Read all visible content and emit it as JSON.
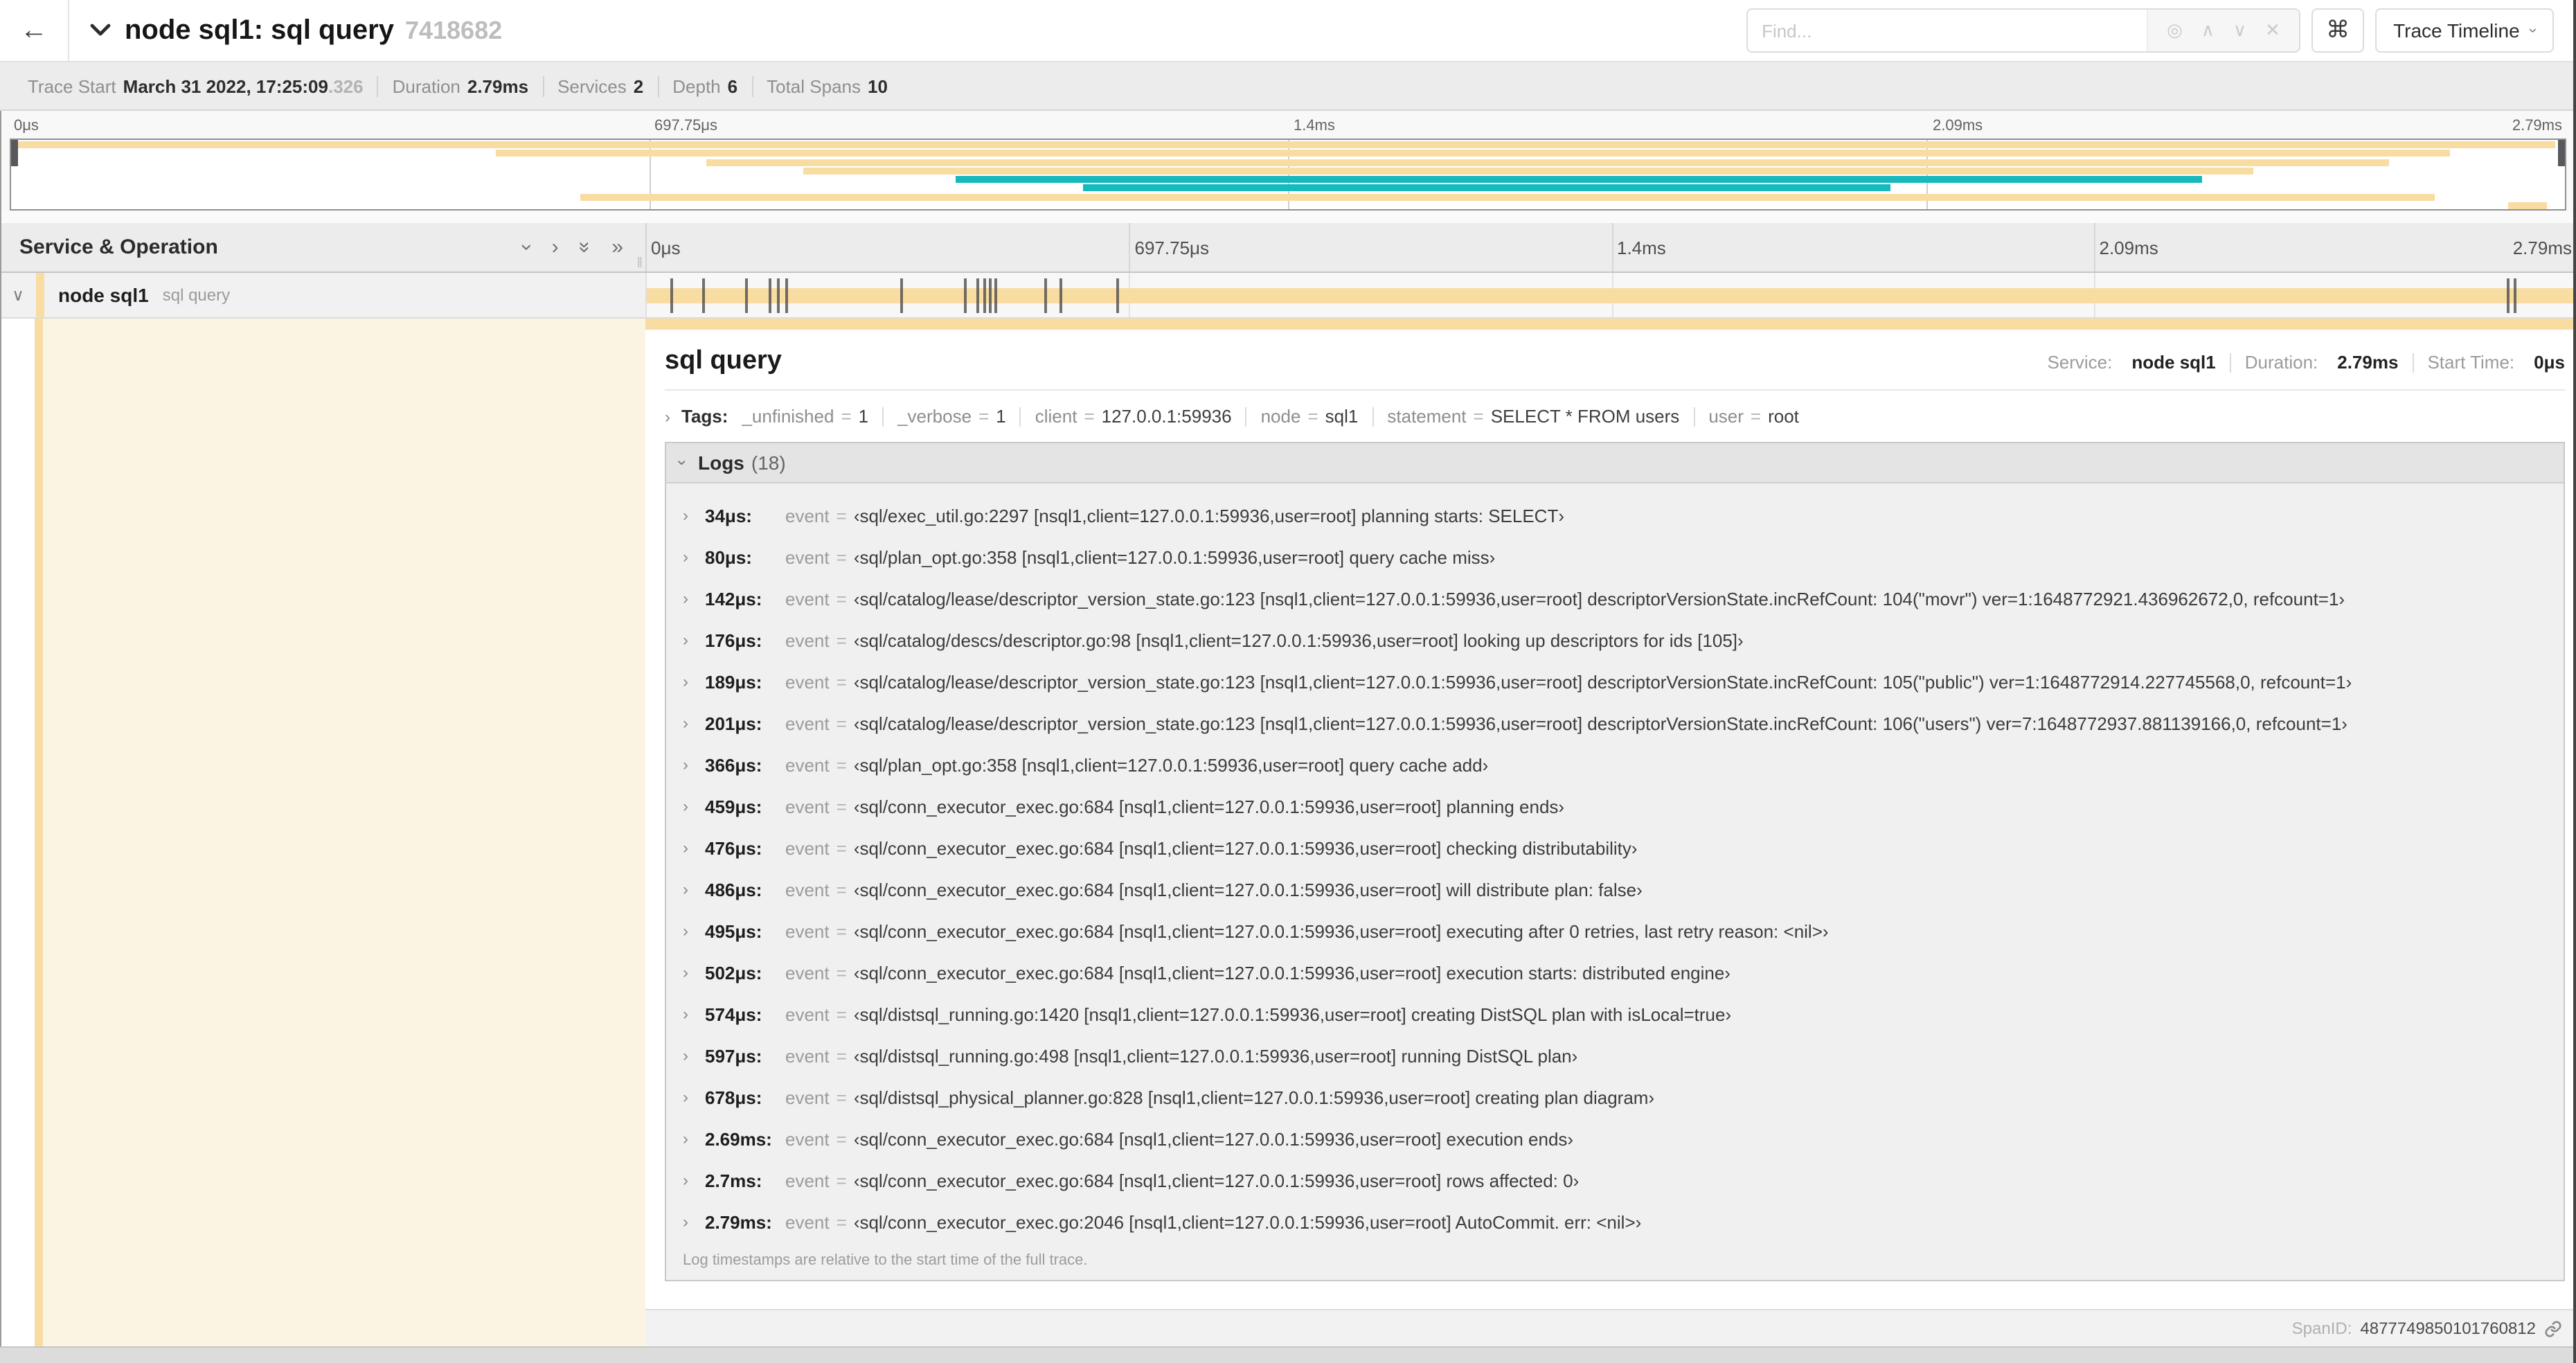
{
  "icons": {
    "back": "←",
    "chevron_right": "›",
    "double_chevron_right": "»",
    "command": "⌘",
    "target": "◎",
    "prev": "∧",
    "next": "∨",
    "close": "✕",
    "resize_grip": "‖"
  },
  "header": {
    "title": "node sql1: sql query",
    "trace_id": "7418682",
    "find_placeholder": "Find...",
    "shortcut_symbol": "⌘",
    "view_selector_label": "Trace Timeline",
    "find_icons": [
      {
        "name": "highlight-matches-icon",
        "glyph": "◎"
      },
      {
        "name": "prev-match-icon",
        "glyph": "∧"
      },
      {
        "name": "next-match-icon",
        "glyph": "∨"
      },
      {
        "name": "clear-search-icon",
        "glyph": "✕"
      }
    ]
  },
  "trace_bar": {
    "items": [
      {
        "label": "Trace Start",
        "value": "March 31 2022, 17:25:09",
        "suffix": ".326"
      },
      {
        "label": "Duration",
        "value": "2.79ms"
      },
      {
        "label": "Services",
        "value": "2"
      },
      {
        "label": "Depth",
        "value": "6"
      },
      {
        "label": "Total Spans",
        "value": "10"
      }
    ]
  },
  "timeline": {
    "total_us": 2790,
    "axis_labels": [
      {
        "text": "0μs",
        "pct": 0
      },
      {
        "text": "697.75μs",
        "pct": 25
      },
      {
        "text": "1.4ms",
        "pct": 50
      },
      {
        "text": "2.09ms",
        "pct": 75
      },
      {
        "text": "2.79ms",
        "pct": 100
      }
    ],
    "colors": {
      "wheat": "#F8DCA1",
      "teal": "#17B8BE",
      "cream": "#FCF4E3"
    }
  },
  "minimap": {
    "bars": [
      {
        "row": 0,
        "start": 0,
        "end": 99.6,
        "color": "wheat"
      },
      {
        "row": 1,
        "start": 19,
        "end": 95.5,
        "color": "wheat"
      },
      {
        "row": 2,
        "start": 27.2,
        "end": 93.1,
        "color": "wheat"
      },
      {
        "row": 3,
        "start": 31,
        "end": 87.8,
        "color": "wheat"
      },
      {
        "row": 4,
        "start": 37,
        "end": 85.8,
        "color": "teal"
      },
      {
        "row": 5,
        "start": 42,
        "end": 73.6,
        "color": "teal"
      },
      {
        "row": 6,
        "start": 22.3,
        "end": 94.9,
        "color": "wheat"
      },
      {
        "row": 7,
        "start": 97.8,
        "end": 99.3,
        "color": "wheat"
      }
    ]
  },
  "span_table": {
    "header": "Service & Operation",
    "controls": [
      {
        "name": "collapse-one-icon",
        "glyph": "›",
        "rotate": true
      },
      {
        "name": "expand-one-icon",
        "glyph": "›",
        "rotate": false
      },
      {
        "name": "collapse-all-icon",
        "glyph": "»",
        "rotate": true
      },
      {
        "name": "expand-all-icon",
        "glyph": "»",
        "rotate": false
      }
    ],
    "row": {
      "service": "node sql1",
      "operation": "sql query"
    }
  },
  "detail": {
    "title": "sql query",
    "meta": [
      {
        "label": "Service:",
        "value": "node sql1"
      },
      {
        "label": "Duration:",
        "value": "2.79ms"
      },
      {
        "label": "Start Time:",
        "value": "0μs"
      }
    ],
    "tags_label": "Tags:",
    "tags": [
      {
        "key": "_unfinished",
        "value": "1"
      },
      {
        "key": "_verbose",
        "value": "1"
      },
      {
        "key": "client",
        "value": "127.0.0.1:59936"
      },
      {
        "key": "node",
        "value": "sql1"
      },
      {
        "key": "statement",
        "value": "SELECT * FROM users"
      },
      {
        "key": "user",
        "value": "root"
      }
    ],
    "logs_label": "Logs",
    "logs_count": "(18)",
    "logs": [
      {
        "time": "34μs:",
        "us": 34,
        "key": "event",
        "value": "‹sql/exec_util.go:2297 [nsql1,client=127.0.0.1:59936,user=root] planning starts: SELECT›"
      },
      {
        "time": "80μs:",
        "us": 80,
        "key": "event",
        "value": "‹sql/plan_opt.go:358 [nsql1,client=127.0.0.1:59936,user=root] query cache miss›"
      },
      {
        "time": "142μs:",
        "us": 142,
        "key": "event",
        "value": "‹sql/catalog/lease/descriptor_version_state.go:123 [nsql1,client=127.0.0.1:59936,user=root] descriptorVersionState.incRefCount: 104(\"movr\") ver=1:1648772921.436962672,0, refcount=1›"
      },
      {
        "time": "176μs:",
        "us": 176,
        "key": "event",
        "value": "‹sql/catalog/descs/descriptor.go:98 [nsql1,client=127.0.0.1:59936,user=root] looking up descriptors for ids [105]›"
      },
      {
        "time": "189μs:",
        "us": 189,
        "key": "event",
        "value": "‹sql/catalog/lease/descriptor_version_state.go:123 [nsql1,client=127.0.0.1:59936,user=root] descriptorVersionState.incRefCount: 105(\"public\") ver=1:1648772914.227745568,0, refcount=1›"
      },
      {
        "time": "201μs:",
        "us": 201,
        "key": "event",
        "value": "‹sql/catalog/lease/descriptor_version_state.go:123 [nsql1,client=127.0.0.1:59936,user=root] descriptorVersionState.incRefCount: 106(\"users\") ver=7:1648772937.881139166,0, refcount=1›"
      },
      {
        "time": "366μs:",
        "us": 366,
        "key": "event",
        "value": "‹sql/plan_opt.go:358 [nsql1,client=127.0.0.1:59936,user=root] query cache add›"
      },
      {
        "time": "459μs:",
        "us": 459,
        "key": "event",
        "value": "‹sql/conn_executor_exec.go:684 [nsql1,client=127.0.0.1:59936,user=root] planning ends›"
      },
      {
        "time": "476μs:",
        "us": 476,
        "key": "event",
        "value": "‹sql/conn_executor_exec.go:684 [nsql1,client=127.0.0.1:59936,user=root] checking distributability›"
      },
      {
        "time": "486μs:",
        "us": 486,
        "key": "event",
        "value": "‹sql/conn_executor_exec.go:684 [nsql1,client=127.0.0.1:59936,user=root] will distribute plan: false›"
      },
      {
        "time": "495μs:",
        "us": 495,
        "key": "event",
        "value": "‹sql/conn_executor_exec.go:684 [nsql1,client=127.0.0.1:59936,user=root] executing after 0 retries, last retry reason: <nil>›"
      },
      {
        "time": "502μs:",
        "us": 502,
        "key": "event",
        "value": "‹sql/conn_executor_exec.go:684 [nsql1,client=127.0.0.1:59936,user=root] execution starts: distributed engine›"
      },
      {
        "time": "574μs:",
        "us": 574,
        "key": "event",
        "value": "‹sql/distsql_running.go:1420 [nsql1,client=127.0.0.1:59936,user=root] creating DistSQL plan with isLocal=true›"
      },
      {
        "time": "597μs:",
        "us": 597,
        "key": "event",
        "value": "‹sql/distsql_running.go:498 [nsql1,client=127.0.0.1:59936,user=root] running DistSQL plan›"
      },
      {
        "time": "678μs:",
        "us": 678,
        "key": "event",
        "value": "‹sql/distsql_physical_planner.go:828 [nsql1,client=127.0.0.1:59936,user=root] creating plan diagram›"
      },
      {
        "time": "2.69ms:",
        "us": 2690,
        "key": "event",
        "value": "‹sql/conn_executor_exec.go:684 [nsql1,client=127.0.0.1:59936,user=root] execution ends›"
      },
      {
        "time": "2.7ms:",
        "us": 2700,
        "key": "event",
        "value": "‹sql/conn_executor_exec.go:684 [nsql1,client=127.0.0.1:59936,user=root] rows affected: 0›"
      },
      {
        "time": "2.79ms:",
        "us": 2790,
        "key": "event",
        "value": "‹sql/conn_executor_exec.go:2046 [nsql1,client=127.0.0.1:59936,user=root] AutoCommit. err: <nil>›"
      }
    ],
    "logs_note": "Log timestamps are relative to the start time of the full trace.",
    "span_id_label": "SpanID:",
    "span_id": "4877749850101760812"
  }
}
